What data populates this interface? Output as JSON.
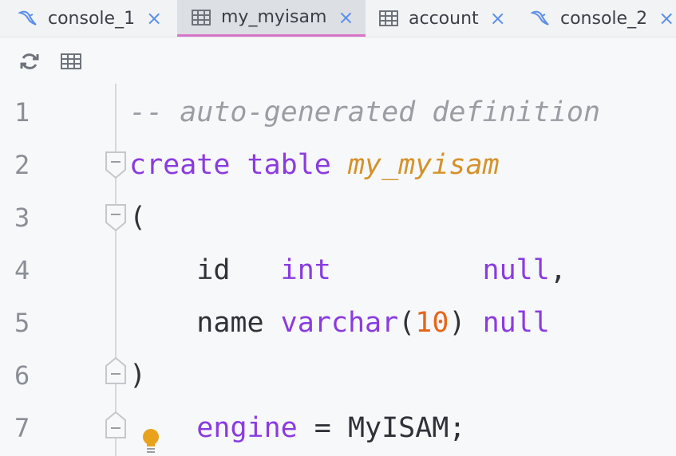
{
  "tabs": [
    {
      "label": "console_1",
      "icon": "mysql-console-icon",
      "active": false
    },
    {
      "label": "my_myisam",
      "icon": "table-icon",
      "active": true
    },
    {
      "label": "account",
      "icon": "table-icon",
      "active": false
    },
    {
      "label": "console_2",
      "icon": "mysql-console-icon",
      "active": false
    }
  ],
  "close_glyph": "×",
  "toolbar": {
    "refresh_icon": "refresh-icon",
    "table_icon": "table-icon"
  },
  "editor": {
    "lines": [
      {
        "number": "1",
        "tokens": [
          {
            "t": "-- auto-generated definition",
            "c": "cm"
          }
        ]
      },
      {
        "number": "2",
        "tokens": [
          {
            "t": "create table ",
            "c": "kw"
          },
          {
            "t": "my_myisam",
            "c": "id"
          }
        ]
      },
      {
        "number": "3",
        "tokens": [
          {
            "t": "(",
            "c": "pl"
          }
        ]
      },
      {
        "number": "4",
        "tokens": [
          {
            "t": "    id   ",
            "c": "pl"
          },
          {
            "t": "int",
            "c": "kw"
          },
          {
            "t": "         ",
            "c": "pl"
          },
          {
            "t": "null",
            "c": "kw"
          },
          {
            "t": ",",
            "c": "pl"
          }
        ]
      },
      {
        "number": "5",
        "tokens": [
          {
            "t": "    name ",
            "c": "pl"
          },
          {
            "t": "varchar",
            "c": "kw"
          },
          {
            "t": "(",
            "c": "pl"
          },
          {
            "t": "10",
            "c": "num"
          },
          {
            "t": ") ",
            "c": "pl"
          },
          {
            "t": "null",
            "c": "kw"
          }
        ]
      },
      {
        "number": "6",
        "tokens": [
          {
            "t": ")",
            "c": "pl"
          }
        ]
      },
      {
        "number": "7",
        "tokens": [
          {
            "t": "    ",
            "c": "pl"
          },
          {
            "t": "engine",
            "c": "kw"
          },
          {
            "t": " = MyISAM;",
            "c": "pl"
          }
        ]
      }
    ]
  },
  "colors": {
    "keyword": "#8a3be0",
    "identifier": "#d5922a",
    "comment": "#9a9da3",
    "number": "#e8651a",
    "active_tab_underline": "#d874c8",
    "close": "#5b8fe8"
  }
}
